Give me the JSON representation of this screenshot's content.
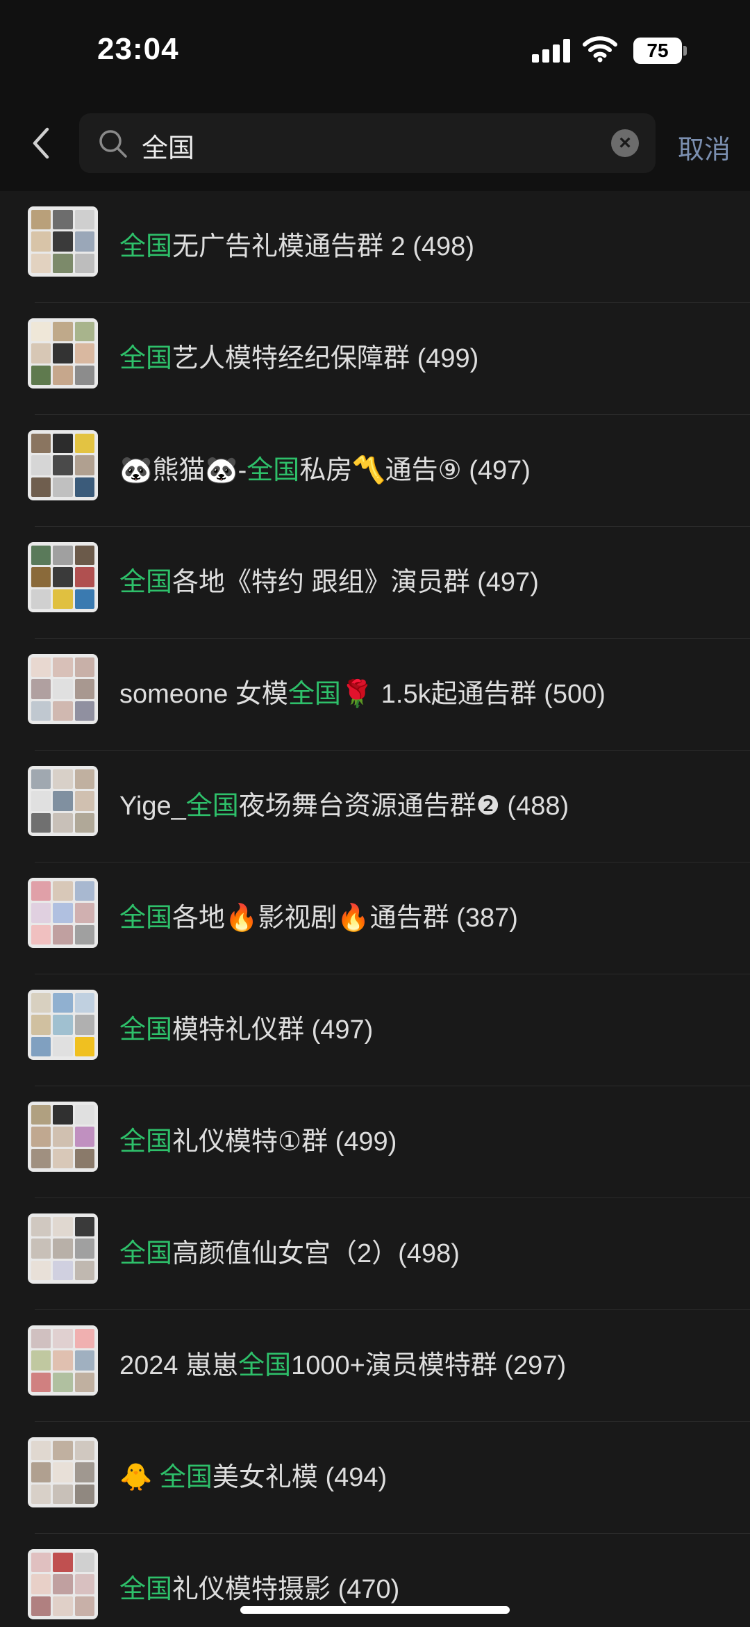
{
  "status_bar": {
    "time": "23:04",
    "battery": "75"
  },
  "search": {
    "query": "全国",
    "cancel_label": "取消"
  },
  "results": [
    {
      "before": "",
      "highlight": "全国",
      "after": "无广告礼模通告群 2 (498)"
    },
    {
      "before": "",
      "highlight": "全国",
      "after": "艺人模特经纪保障群 (499)"
    },
    {
      "before": "🐼熊猫🐼-",
      "highlight": "全国",
      "after": "私房〽️通告⑨ (497)"
    },
    {
      "before": "",
      "highlight": "全国",
      "after": "各地《特约 跟组》演员群 (497)"
    },
    {
      "before": "someone 女模",
      "highlight": "全国",
      "after": "🌹 1.5k起通告群 (500)"
    },
    {
      "before": "Yige_",
      "highlight": "全国",
      "after": "夜场舞台资源通告群❷ (488)"
    },
    {
      "before": "",
      "highlight": "全国",
      "after": "各地🔥影视剧🔥通告群 (387)"
    },
    {
      "before": "",
      "highlight": "全国",
      "after": "模特礼仪群 (497)"
    },
    {
      "before": "",
      "highlight": "全国",
      "after": "礼仪模特①群 (499)"
    },
    {
      "before": "",
      "highlight": "全国",
      "after": "高颜值仙女宫（2）(498)"
    },
    {
      "before": "2024 崽崽",
      "highlight": "全国",
      "after": "1000+演员模特群 (297)"
    },
    {
      "before": "🐥 ",
      "highlight": "全国",
      "after": "美女礼模 (494)"
    },
    {
      "before": "",
      "highlight": "全国",
      "after": "礼仪模特摄影 (470)"
    }
  ],
  "colors": {
    "highlight": "#2ec06a",
    "cancel": "#7b8fb0",
    "background": "#191919"
  },
  "icons": [
    "back-arrow-icon",
    "search-icon",
    "clear-icon",
    "signal-icon",
    "wifi-icon",
    "battery-icon"
  ]
}
